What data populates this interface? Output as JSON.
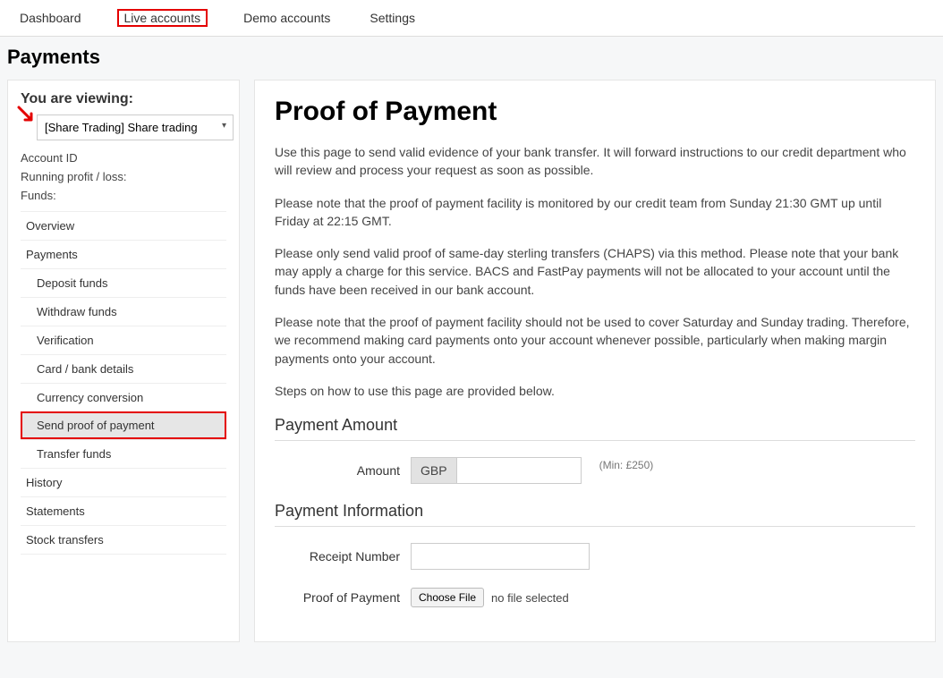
{
  "topnav": {
    "items": [
      {
        "label": "Dashboard"
      },
      {
        "label": "Live accounts",
        "highlighted": true
      },
      {
        "label": "Demo accounts"
      },
      {
        "label": "Settings"
      }
    ]
  },
  "page_title": "Payments",
  "sidebar": {
    "viewing_label": "You are viewing:",
    "account_select_value": "[Share Trading] Share trading",
    "meta": {
      "account_id_label": "Account ID",
      "running_pl_label": "Running profit / loss:",
      "funds_label": "Funds:"
    },
    "nav": [
      {
        "label": "Overview",
        "sub": false
      },
      {
        "label": "Payments",
        "sub": false
      },
      {
        "label": "Deposit funds",
        "sub": true
      },
      {
        "label": "Withdraw funds",
        "sub": true
      },
      {
        "label": "Verification",
        "sub": true
      },
      {
        "label": "Card / bank details",
        "sub": true
      },
      {
        "label": "Currency conversion",
        "sub": true
      },
      {
        "label": "Send proof of payment",
        "sub": true,
        "active": true
      },
      {
        "label": "Transfer funds",
        "sub": true
      },
      {
        "label": "History",
        "sub": false
      },
      {
        "label": "Statements",
        "sub": false
      },
      {
        "label": "Stock transfers",
        "sub": false
      }
    ]
  },
  "content": {
    "heading": "Proof of Payment",
    "paragraphs": [
      "Use this page to send valid evidence of your bank transfer. It will forward instructions to our credit department who will review and process your request as soon as possible.",
      "Please note that the proof of payment facility is monitored by our credit team from Sunday 21:30 GMT up until Friday at 22:15 GMT.",
      "Please only send valid proof of same-day sterling transfers (CHAPS) via this method. Please note that your bank may apply a charge for this service. BACS and FastPay payments will not be allocated to your account until the funds have been received in our bank account.",
      "Please note that the proof of payment facility should not be used to cover Saturday and Sunday trading. Therefore, we recommend making card payments onto your account whenever possible, particularly when making margin payments onto your account.",
      "Steps on how to use this page are provided below."
    ],
    "amount_section": {
      "heading": "Payment Amount",
      "label": "Amount",
      "currency": "GBP",
      "hint": "(Min: £250)"
    },
    "info_section": {
      "heading": "Payment Information",
      "receipt_label": "Receipt Number",
      "proof_label": "Proof of Payment",
      "choose_file": "Choose File",
      "no_file": "no file selected"
    }
  }
}
